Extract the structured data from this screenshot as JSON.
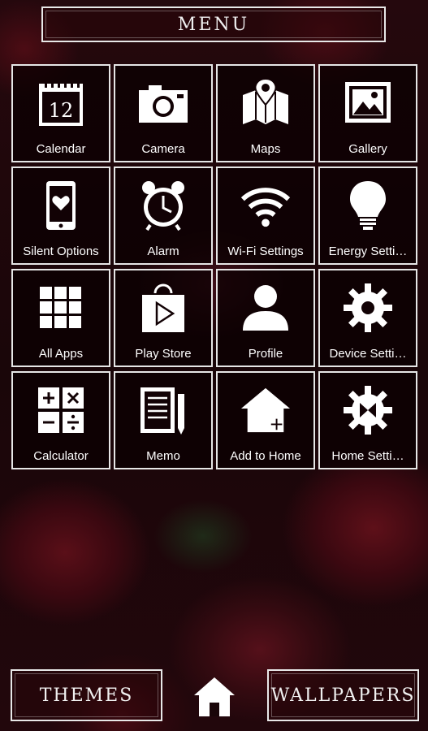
{
  "header": {
    "title": "MENU"
  },
  "tiles": [
    {
      "label": "Calendar",
      "icon": "calendar-icon",
      "day": "12"
    },
    {
      "label": "Camera",
      "icon": "camera-icon"
    },
    {
      "label": "Maps",
      "icon": "map-icon"
    },
    {
      "label": "Gallery",
      "icon": "gallery-icon"
    },
    {
      "label": "Silent Options",
      "icon": "phone-heart-icon"
    },
    {
      "label": "Alarm",
      "icon": "alarm-clock-icon"
    },
    {
      "label": "Wi-Fi Settings",
      "icon": "wifi-icon"
    },
    {
      "label": "Energy Setti…",
      "icon": "bulb-icon"
    },
    {
      "label": "All Apps",
      "icon": "grid-icon"
    },
    {
      "label": "Play Store",
      "icon": "play-store-icon"
    },
    {
      "label": "Profile",
      "icon": "person-icon"
    },
    {
      "label": "Device Setti…",
      "icon": "gear-icon"
    },
    {
      "label": "Calculator",
      "icon": "calculator-icon"
    },
    {
      "label": "Memo",
      "icon": "memo-icon"
    },
    {
      "label": "Add to Home",
      "icon": "add-home-icon"
    },
    {
      "label": "Home Setti…",
      "icon": "home-gear-icon"
    }
  ],
  "footer": {
    "themes_label": "THEMES",
    "wallpapers_label": "WALLPAPERS",
    "home_icon": "home-icon"
  },
  "colors": {
    "border": "#e6e6e6",
    "tile_bg": "#0a0002",
    "background": "#1a0a0c"
  }
}
